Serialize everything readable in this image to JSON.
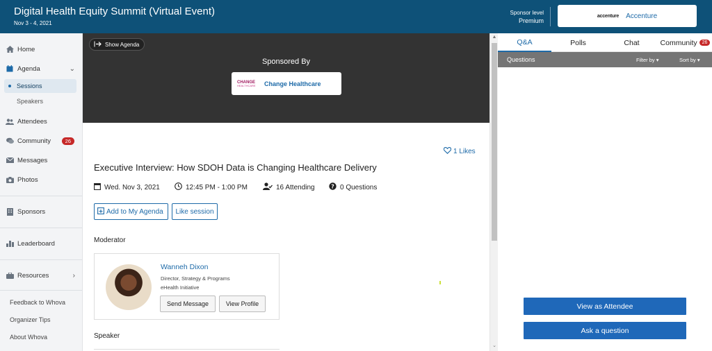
{
  "header": {
    "title": "Digital Health Equity Summit (Virtual Event)",
    "dates": "Nov 3 - 4, 2021",
    "sponsor_level_label": "Sponsor level",
    "sponsor_level": "Premium",
    "sponsor_logo_text": "accenture",
    "sponsor_name": "Accenture"
  },
  "sidebar": {
    "items": [
      {
        "label": "Home",
        "icon": "home-icon"
      },
      {
        "label": "Agenda",
        "icon": "calendar-icon"
      },
      {
        "label": "Sessions"
      },
      {
        "label": "Speakers"
      },
      {
        "label": "Attendees",
        "icon": "people-icon"
      },
      {
        "label": "Community",
        "icon": "chat-icon",
        "badge": "26"
      },
      {
        "label": "Messages",
        "icon": "mail-icon"
      },
      {
        "label": "Photos",
        "icon": "camera-icon"
      },
      {
        "label": "Sponsors",
        "icon": "building-icon"
      },
      {
        "label": "Leaderboard",
        "icon": "leaderboard-icon"
      },
      {
        "label": "Resources",
        "icon": "briefcase-icon"
      }
    ],
    "footer_links": [
      "Feedback to Whova",
      "Organizer Tips",
      "About Whova"
    ]
  },
  "banner": {
    "show_agenda": "Show Agenda",
    "sponsored_by": "Sponsored By",
    "sponsor_logo_line1": "CHANGE",
    "sponsor_logo_line2": "HEALTHCARE",
    "sponsor_name": "Change Healthcare"
  },
  "session": {
    "likes": "1 Likes",
    "title": "Executive Interview: How SDOH Data is Changing Healthcare Delivery",
    "date": "Wed. Nov 3, 2021",
    "time": "12:45 PM - 1:00 PM",
    "attending": "16 Attending",
    "questions": "0 Questions",
    "add_to_agenda": "Add to My Agenda",
    "like_session": "Like session",
    "moderator_label": "Moderator",
    "speaker_label": "Speaker"
  },
  "moderator": {
    "name": "Wanneh Dixon",
    "role": "Director, Strategy & Programs",
    "org": "eHealth Initiative",
    "send_message": "Send Message",
    "view_profile": "View Profile"
  },
  "right_panel": {
    "tabs": [
      "Q&A",
      "Polls",
      "Chat",
      "Community"
    ],
    "community_badge": "26",
    "questions_label": "Questions",
    "filter_by": "Filter by ▾",
    "sort_by": "Sort by ▾",
    "view_as_attendee": "View as Attendee",
    "ask_question": "Ask a question"
  },
  "colors": {
    "header_bg": "#0e5178",
    "accent": "#1d6aa8",
    "badge": "#c62828",
    "primary_button": "#1f68b9"
  }
}
